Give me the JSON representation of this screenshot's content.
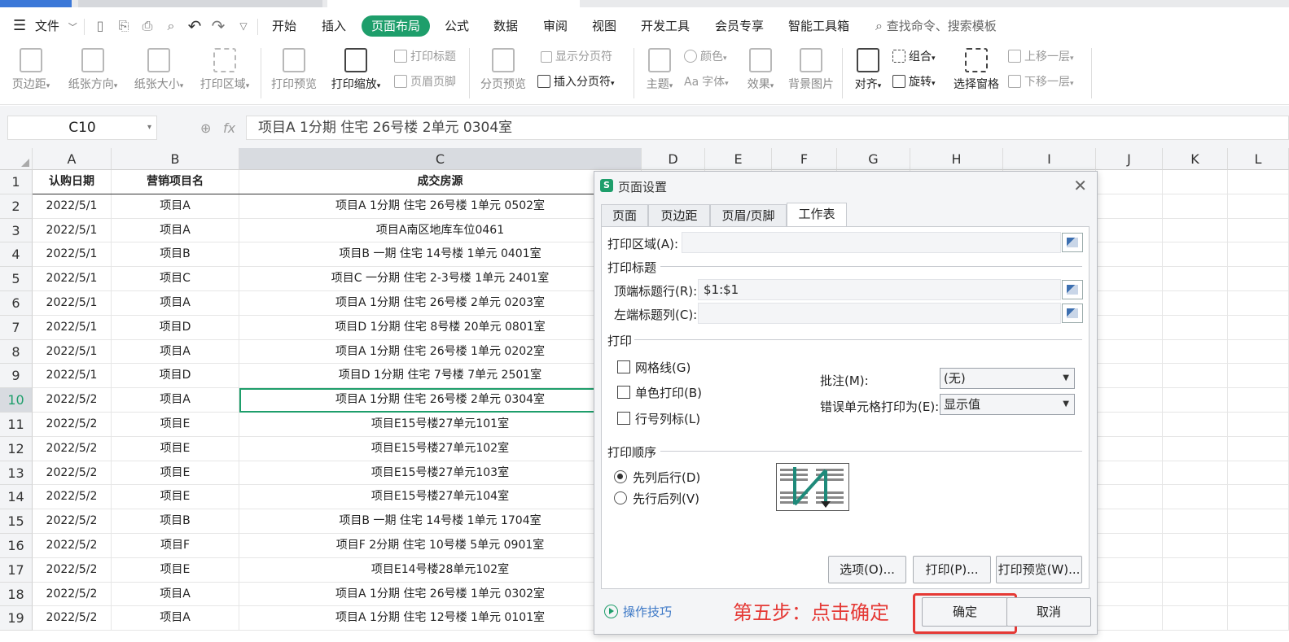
{
  "menu": {
    "file_label": "文件",
    "tabs": [
      "开始",
      "插入",
      "页面布局",
      "公式",
      "数据",
      "审阅",
      "视图",
      "开发工具",
      "会员专享",
      "智能工具箱"
    ],
    "active_tab_index": 2,
    "search_placeholder": "查找命令、搜索模板"
  },
  "ribbon": {
    "margins": "页边距",
    "orientation": "纸张方向",
    "size": "纸张大小",
    "print_area": "打印区域",
    "print_preview": "打印预览",
    "print_scale": "打印缩放",
    "print_titles": "打印标题",
    "header_footer": "页眉页脚",
    "page_break_preview": "分页预览",
    "show_page_breaks": "显示分页符",
    "insert_page_break": "插入分页符",
    "theme": "主题",
    "colors": "颜色",
    "fonts": "字体",
    "effects": "效果",
    "background": "背景图片",
    "align": "对齐",
    "group": "组合",
    "rotate": "旋转",
    "selection_pane": "选择窗格",
    "bring_forward": "上移一层",
    "send_backward": "下移一层"
  },
  "formula_bar": {
    "name_box": "C10",
    "content": "项目A 1分期 住宅 26号楼 2单元 0304室"
  },
  "sheet": {
    "columns": [
      "A",
      "B",
      "C",
      "D",
      "E",
      "F",
      "G",
      "H",
      "I",
      "J",
      "K",
      "L"
    ],
    "row_numbers": [
      "1",
      "2",
      "3",
      "4",
      "5",
      "6",
      "7",
      "8",
      "9",
      "10",
      "11",
      "12",
      "13",
      "14",
      "15",
      "16",
      "17",
      "18",
      "19"
    ],
    "headers": [
      "认购日期",
      "营销项目名",
      "成交房源"
    ],
    "rows": [
      [
        "2022/5/1",
        "项目A",
        "项目A 1分期 住宅 26号楼 1单元 0502室"
      ],
      [
        "2022/5/1",
        "项目A",
        "项目A南区地库车位0461"
      ],
      [
        "2022/5/1",
        "项目B",
        "项目B 一期 住宅 14号楼 1单元 0401室"
      ],
      [
        "2022/5/1",
        "项目C",
        "项目C 一分期 住宅 2-3号楼 1单元 2401室"
      ],
      [
        "2022/5/1",
        "项目A",
        "项目A 1分期 住宅 26号楼 2单元 0203室"
      ],
      [
        "2022/5/1",
        "项目D",
        "项目D 1分期 住宅 8号楼 20单元 0801室"
      ],
      [
        "2022/5/1",
        "项目A",
        "项目A 1分期 住宅 26号楼 1单元 0202室"
      ],
      [
        "2022/5/1",
        "项目D",
        "项目D 1分期 住宅 7号楼 7单元 2501室"
      ],
      [
        "2022/5/2",
        "项目A",
        "项目A 1分期 住宅 26号楼 2单元 0304室"
      ],
      [
        "2022/5/2",
        "项目E",
        "项目E15号楼27单元101室"
      ],
      [
        "2022/5/2",
        "项目E",
        "项目E15号楼27单元102室"
      ],
      [
        "2022/5/2",
        "项目E",
        "项目E15号楼27单元103室"
      ],
      [
        "2022/5/2",
        "项目E",
        "项目E15号楼27单元104室"
      ],
      [
        "2022/5/2",
        "项目B",
        "项目B 一期 住宅 14号楼 1单元 1704室"
      ],
      [
        "2022/5/2",
        "项目F",
        "项目F 2分期 住宅 10号楼 5单元 0901室"
      ],
      [
        "2022/5/2",
        "项目E",
        "项目E14号楼28单元102室"
      ],
      [
        "2022/5/2",
        "项目A",
        "项目A 1分期 住宅 26号楼 1单元 0302室"
      ],
      [
        "2022/5/2",
        "项目A",
        "项目A 1分期 住宅 12号楼 1单元 0101室"
      ]
    ]
  },
  "dialog": {
    "title": "页面设置",
    "tabs": [
      "页面",
      "页边距",
      "页眉/页脚",
      "工作表"
    ],
    "print_area_label": "打印区域(A):",
    "print_area_value": "",
    "print_titles_group": "打印标题",
    "top_rows_label": "顶端标题行(R):",
    "top_rows_value": "$1:$1",
    "left_cols_label": "左端标题列(C):",
    "left_cols_value": "",
    "print_group": "打印",
    "gridlines": "网格线(G)",
    "black_white": "单色打印(B)",
    "row_col_headings": "行号列标(L)",
    "comments_label": "批注(M):",
    "comments_value": "(无)",
    "errors_label": "错误单元格打印为(E):",
    "errors_value": "显示值",
    "order_group": "打印顺序",
    "down_then_over": "先列后行(D)",
    "over_then_down": "先行后列(V)",
    "options_btn": "选项(O)...",
    "print_btn": "打印(P)...",
    "preview_btn": "打印预览(W)...",
    "tips": "操作技巧",
    "ok": "确定",
    "cancel": "取消"
  },
  "annotation": "第五步：点击确定"
}
